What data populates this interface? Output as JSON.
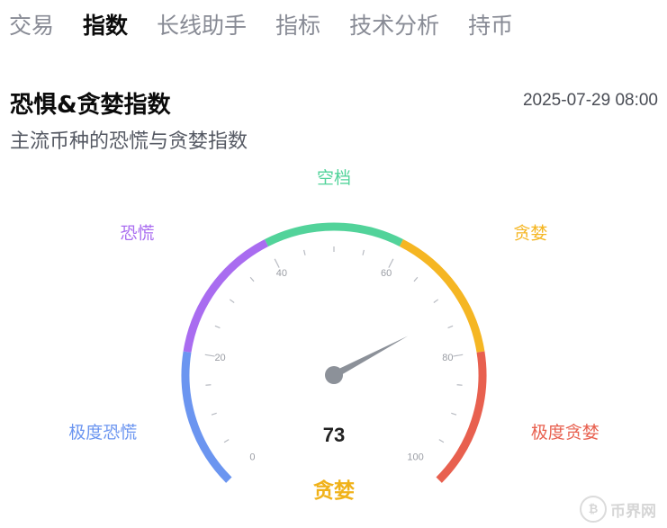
{
  "tabs": [
    {
      "label": "交易",
      "active": false
    },
    {
      "label": "指数",
      "active": true
    },
    {
      "label": "长线助手",
      "active": false
    },
    {
      "label": "指标",
      "active": false
    },
    {
      "label": "技术分析",
      "active": false
    },
    {
      "label": "持币",
      "active": false
    }
  ],
  "header": {
    "title": "恐惧&贪婪指数",
    "timestamp": "2025-07-29 08:00",
    "subtitle": "主流币种的恐慌与贪婪指数"
  },
  "gauge": {
    "value": 73,
    "value_text": "73",
    "status_label": "贪婪",
    "status_color": "#f0b21a",
    "min": 0,
    "max": 100,
    "tick_labels": [
      "0",
      "20",
      "40",
      "60",
      "80",
      "100"
    ],
    "zones": [
      {
        "label": "极度恐慌",
        "from": 0,
        "to": 20,
        "color": "#6b95f0"
      },
      {
        "label": "恐慌",
        "from": 20,
        "to": 40,
        "color": "#a96cf0"
      },
      {
        "label": "空档",
        "from": 40,
        "to": 60,
        "color": "#52d39a"
      },
      {
        "label": "贪婪",
        "from": 60,
        "to": 80,
        "color": "#f5b623"
      },
      {
        "label": "极度贪婪",
        "from": 80,
        "to": 100,
        "color": "#e8604f"
      }
    ]
  },
  "watermark": {
    "icon": "bitcoin-coin-icon",
    "text": "币界网"
  }
}
